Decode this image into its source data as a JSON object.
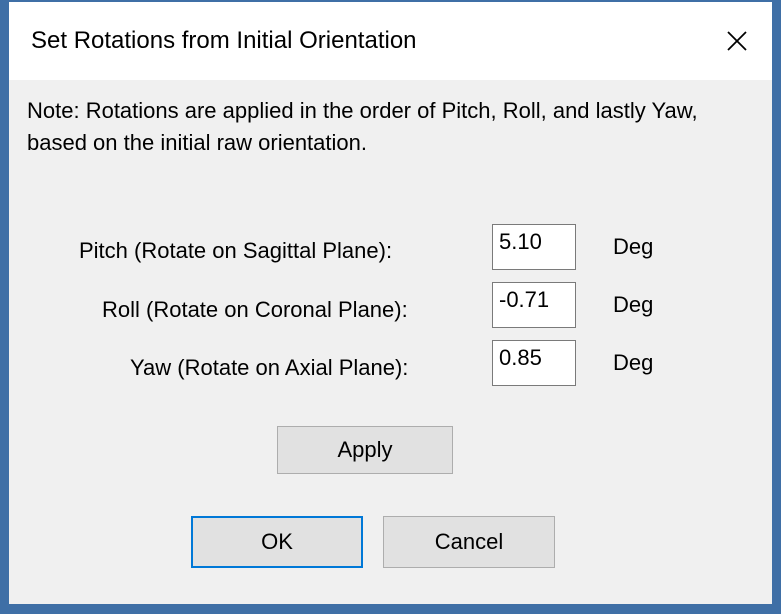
{
  "dialog": {
    "title": "Set Rotations from Initial Orientation",
    "note": "Note: Rotations are applied in the order of Pitch, Roll, and lastly Yaw, based on the initial raw orientation."
  },
  "rotations": [
    {
      "label": "Pitch (Rotate on Sagittal Plane):",
      "value": "5.10",
      "unit": "Deg"
    },
    {
      "label": "Roll (Rotate on Coronal Plane):",
      "value": "-0.71",
      "unit": "Deg"
    },
    {
      "label": "Yaw (Rotate on Axial Plane):",
      "value": "0.85",
      "unit": "Deg"
    }
  ],
  "buttons": {
    "apply": "Apply",
    "ok": "OK",
    "cancel": "Cancel"
  },
  "colors": {
    "window_border": "#3f6fa6",
    "default_button_border": "#0078d7"
  },
  "icons": {
    "close": "close-icon"
  }
}
